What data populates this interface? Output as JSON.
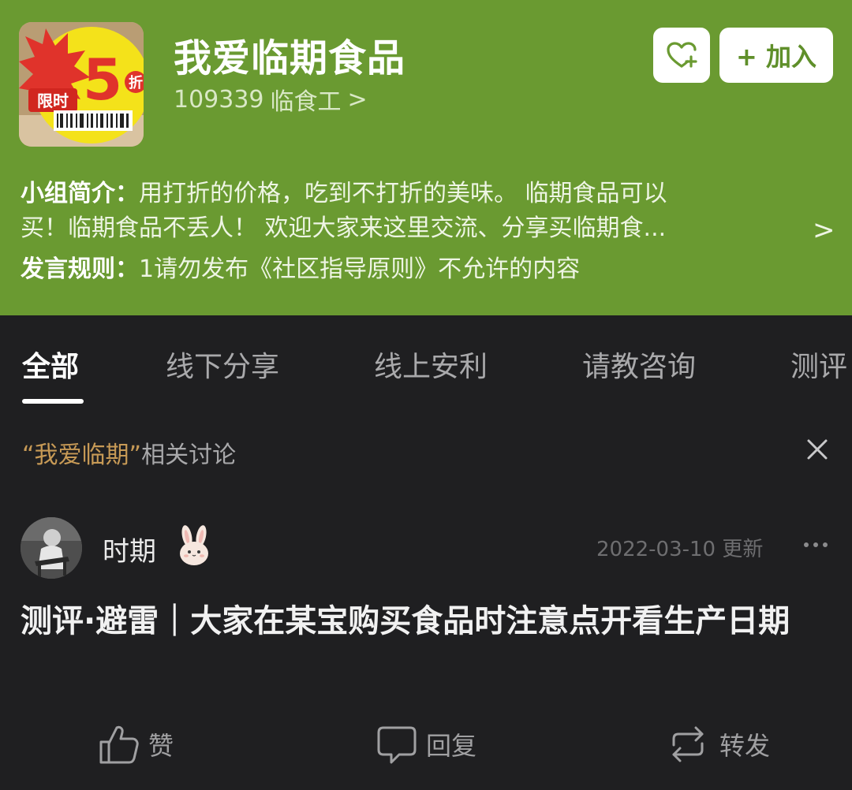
{
  "colors": {
    "header_bg": "#6a9a31",
    "page_bg": "#1f1f21",
    "accent_keyword": "#c79a56",
    "join_text": "#5f8f2a"
  },
  "group": {
    "title": "我爱临期食品",
    "member_count": "109339",
    "member_name": "临食工",
    "meta_chevron": ">",
    "thumb_text_top": "限时",
    "thumb_text_big": "5",
    "thumb_text_unit": "折",
    "fav_icon": "heart-plus-icon",
    "join_label": "+ 加入"
  },
  "intro": {
    "label": "小组简介：",
    "line1": "用打折的价格，吃到不打折的美味。 临期食品可以",
    "line2": "买！临期食品不丢人！  欢迎大家来这里交流、分享买临期食...",
    "chevron": ">"
  },
  "rules": {
    "label": "发言规则：",
    "text": "1请勿发布《社区指导原则》不允许的内容"
  },
  "tabs": [
    {
      "label": "全部",
      "active": true
    },
    {
      "label": "线下分享",
      "active": false
    },
    {
      "label": "线上安利",
      "active": false
    },
    {
      "label": "请教咨询",
      "active": false
    },
    {
      "label": "测评",
      "active": false
    }
  ],
  "related": {
    "keyword": "“我爱临期”",
    "suffix": "相关讨论",
    "close_icon": "close-icon"
  },
  "post": {
    "author": "时期",
    "badge_icon": "rabbit-badge-icon",
    "time": "2022-03-10 更新",
    "title": "测评·避雷｜大家在某宝购买食品时注意点开看生产日期"
  },
  "actions": {
    "like": "赞",
    "reply": "回复",
    "share": "转发"
  }
}
